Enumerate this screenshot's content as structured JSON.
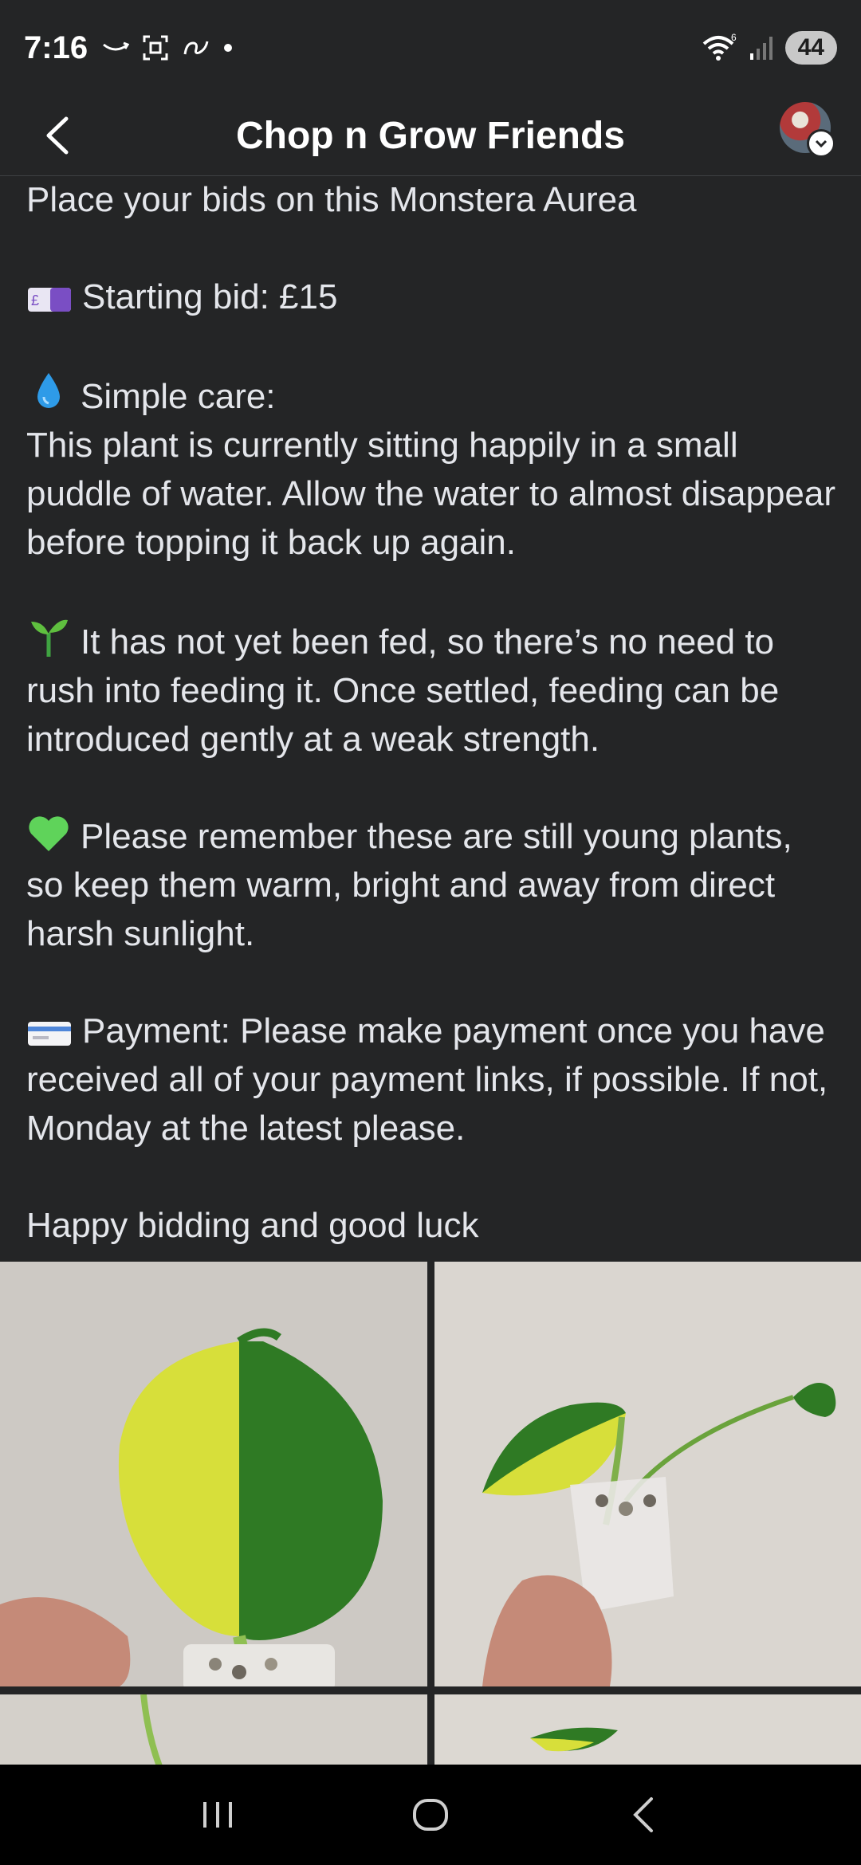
{
  "status_bar": {
    "time": "7:16",
    "battery": "44",
    "left_icons": [
      "amazon-smile-icon",
      "screenshot-icon",
      "link-icon",
      "dot-icon"
    ],
    "right_icons": [
      "wifi-icon",
      "signal-icon"
    ]
  },
  "header": {
    "title": "Chop n Grow Friends"
  },
  "post": {
    "line_intro": "Place your bids on this Monstera Aurea",
    "starting_bid": "Starting bid: £15",
    "care_heading": "Simple care:",
    "care_text": "This plant is currently sitting happily in a small puddle of water. Allow the water to almost disappear before topping it back up again.",
    "feeding_text": "It has not yet been fed, so there’s no need to rush into feeding it. Once settled, feeding can be introduced gently at a weak strength.",
    "young_plants_text": "Please remember these are still young plants, so keep them warm, bright and away from direct harsh sunlight.",
    "payment_text": "Payment: Please make payment once you have received all of your payment links, if possible. If not, Monday at the latest please.",
    "sign_off": "Happy bidding and good luck"
  },
  "icons": {
    "banknote": "pound-banknote-icon",
    "water": "water-droplet-icon",
    "seedling": "seedling-icon",
    "heart": "green-heart-icon",
    "card": "credit-card-icon"
  },
  "colors": {
    "background": "#242526",
    "text": "#e4e6eb",
    "heart_green": "#5fd35a",
    "droplet_blue": "#2e9be8"
  }
}
